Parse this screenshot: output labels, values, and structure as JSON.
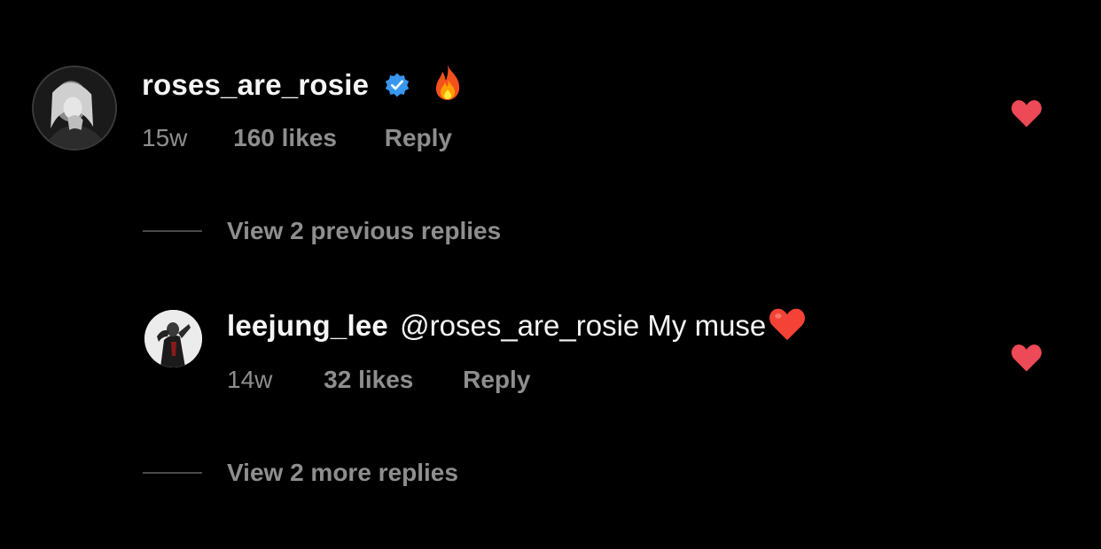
{
  "comments": [
    {
      "username": "roses_are_rosie",
      "verified": true,
      "text_emoji": "fire",
      "time": "15w",
      "likes": "160 likes",
      "reply": "Reply",
      "liked": true
    },
    {
      "username": "leejung_lee",
      "mention": "@roses_are_rosie",
      "text": " My muse",
      "text_emoji": "red-heart",
      "time": "14w",
      "likes": "32 likes",
      "reply": "Reply",
      "liked": true
    }
  ],
  "view_previous": "View 2 previous replies",
  "view_more": "View 2 more replies",
  "colors": {
    "background": "#000000",
    "text_primary": "#f5f5f5",
    "text_secondary": "#8e8e8e",
    "verified_blue": "#3897f0",
    "like_red": "#ed4956"
  }
}
